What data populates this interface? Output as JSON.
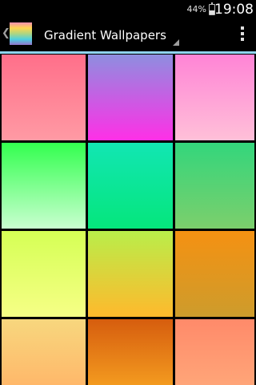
{
  "status_bar": {
    "battery_percent": "44%",
    "battery_level": 0.44,
    "time": "19:08"
  },
  "action_bar": {
    "title": "Gradient Wallpapers",
    "up_icon": "chevron-left-icon",
    "overflow_icon": "overflow-menu-icon"
  },
  "wallpapers": [
    {
      "name": "pink",
      "from": "#ff6f8a",
      "to": "#ff9aa4"
    },
    {
      "name": "purple-magenta",
      "from": "#8e8ee0",
      "to": "#ff2fe6"
    },
    {
      "name": "light-pink",
      "from": "#ff84d6",
      "to": "#ffc0d8"
    },
    {
      "name": "green",
      "from": "#33ff4f",
      "to": "#c9ffd0"
    },
    {
      "name": "teal",
      "from": "#12e6b3",
      "to": "#05e67c"
    },
    {
      "name": "sea-green",
      "from": "#33d67c",
      "to": "#7ccf6c"
    },
    {
      "name": "lime-yellow",
      "from": "#d5ff55",
      "to": "#f6ff86"
    },
    {
      "name": "lime-orange",
      "from": "#b9ee4a",
      "to": "#ffb92c"
    },
    {
      "name": "orange",
      "from": "#f59112",
      "to": "#cd9c2c"
    },
    {
      "name": "peach",
      "from": "#f7d77e",
      "to": "#ffb86a"
    },
    {
      "name": "dark-orange",
      "from": "#d65d0e",
      "to": "#f39a1f"
    },
    {
      "name": "salmon",
      "from": "#ff8a6a",
      "to": "#ffa578"
    }
  ]
}
